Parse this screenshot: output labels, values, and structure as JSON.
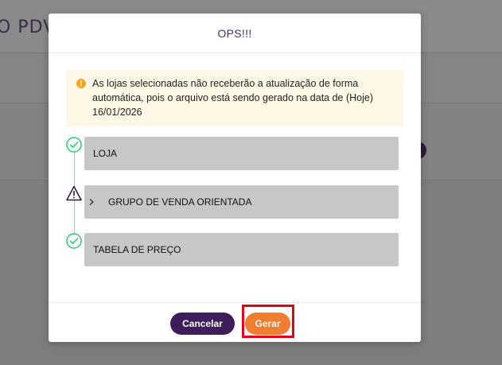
{
  "background": {
    "title": "O PDV"
  },
  "modal": {
    "title": "OPS!!!",
    "alert": {
      "icon": "exclamation-circle-icon",
      "line1": "As lojas selecionadas não receberão a atualização de forma",
      "line2": "automática, pois o arquivo está sendo gerado na data de (Hoje)",
      "line3": "16/01/2026"
    },
    "steps": [
      {
        "label": "LOJA",
        "status_icon": "check-circle-icon"
      },
      {
        "label": "GRUPO DE VENDA ORIENTADA",
        "status_icon": "warning-triangle-icon",
        "expand_icon": "chevron-right-icon"
      },
      {
        "label": "TABELA DE PREÇO",
        "status_icon": "check-circle-icon"
      }
    ],
    "buttons": {
      "cancel_label": "Cancelar",
      "generate_label": "Gerar"
    },
    "colors": {
      "accent": "#3f1d5b",
      "primary_action": "#f07d30",
      "success": "#2ecc71",
      "warning_bg": "#fff8e6",
      "highlight": "#e0001a"
    }
  }
}
